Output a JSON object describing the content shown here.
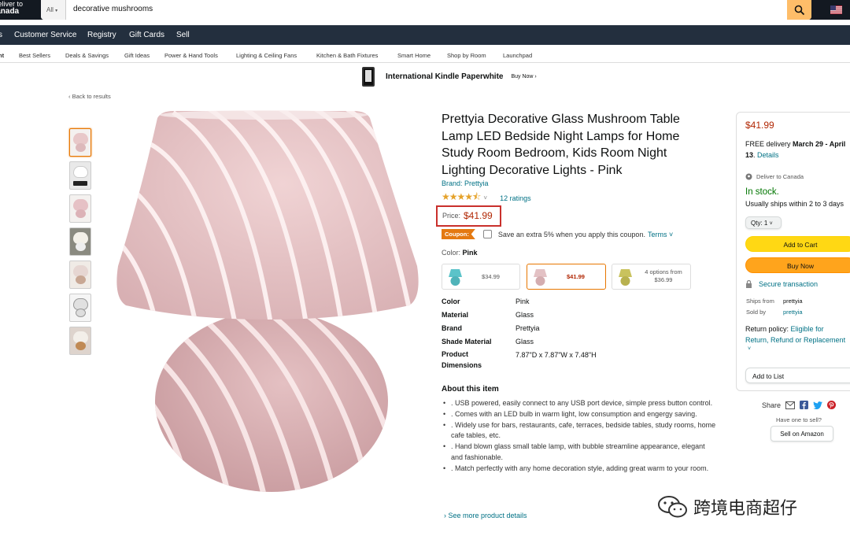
{
  "header": {
    "deliver_line1": "Deliver to",
    "deliver_line2": "Canada",
    "search_category": "All",
    "search_value": "decorative mushrooms"
  },
  "nav": [
    "Customer Service",
    "Registry",
    "Gift Cards",
    "Sell"
  ],
  "nav_partial": "s",
  "subnav": [
    "Best Sellers",
    "Deals & Savings",
    "Gift Ideas",
    "Power & Hand Tools",
    "Lighting & Ceiling Fans",
    "Kitchen & Bath Fixtures",
    "Smart Home",
    "Shop by Room",
    "Launchpad"
  ],
  "subnav_partial": "nt",
  "banner": {
    "title": "International Kindle Paperwhite",
    "cta": "Buy Now ›"
  },
  "back_link": "‹ Back to results",
  "product": {
    "title": "Prettyia Decorative Glass Mushroom Table Lamp LED Bedside Night Lamps for Home Study Room Bedroom, Kids Room Night Lighting Decorative Lights - Pink",
    "brand": "Brand: Prettyia",
    "stars": "★★★★⯪",
    "ratings": "12 ratings",
    "price_label": "Price:",
    "price": "$41.99",
    "coupon_tag": "Coupon:",
    "coupon_text": "Save an extra 5% when you apply this coupon.",
    "coupon_terms": "Terms ˅",
    "color_label": "Color:",
    "color_value": "Pink",
    "swatches": [
      {
        "price": "$34.99",
        "color": "#5bc3c9"
      },
      {
        "price": "$41.99",
        "color": "#e3c1c4"
      },
      {
        "price": "4 options from $36.99",
        "color": "#c9c25e"
      }
    ],
    "specs": [
      {
        "k": "Color",
        "v": "Pink"
      },
      {
        "k": "Material",
        "v": "Glass"
      },
      {
        "k": "Brand",
        "v": "Prettyia"
      },
      {
        "k": "Shade Material",
        "v": "Glass"
      },
      {
        "k": "Product Dimensions",
        "v": "7.87\"D x 7.87\"W x 7.48\"H"
      }
    ],
    "about_title": "About this item",
    "bullets": [
      ". USB powered, easily connect to any USB port device, simple press button control.",
      ". Comes with an LED bulb in warm light, low consumption and engergy saving.",
      ". Widely use for bars, restaurants, cafe, terraces, bedside tables, study rooms, home cafe tables, etc.",
      ". Hand blown glass small table lamp, with bubble streamline appearance, elegant and fashionable.",
      ". Match perfectly with any home decoration style, adding great warm to your room."
    ],
    "see_more": "› See more product details"
  },
  "buybox": {
    "price": "$41.99",
    "delivery_prefix": "FREE delivery ",
    "delivery_dates": "March 29 - April",
    "delivery_line2_bold": "13",
    "delivery_details": "Details",
    "deliver_to": "Deliver to Canada",
    "stock": "In stock.",
    "ships": "Usually ships within 2 to 3 days",
    "qty": "Qty: 1",
    "add_to_cart": "Add to Cart",
    "buy_now": "Buy Now",
    "secure": "Secure transaction",
    "ships_from_label": "Ships from",
    "ships_from_value": "prettyia",
    "sold_by_label": "Sold by",
    "sold_by_value": "prettyia",
    "return_label": "Return policy:",
    "return_link1": "Eligible for",
    "return_link2": "Return, Refund or Replacement",
    "return_more": "˅",
    "add_to_list": "Add to List",
    "share": "Share",
    "have_one": "Have one to sell?",
    "sell_btn": "Sell on Amazon"
  },
  "watermark": "跨境电商超仔",
  "colors": {
    "accent": "#e77600",
    "price": "#b12704",
    "link": "#007185",
    "instock": "#007600",
    "nav": "#232f3e",
    "top": "#131921",
    "lamp": "#e8c8c9"
  }
}
